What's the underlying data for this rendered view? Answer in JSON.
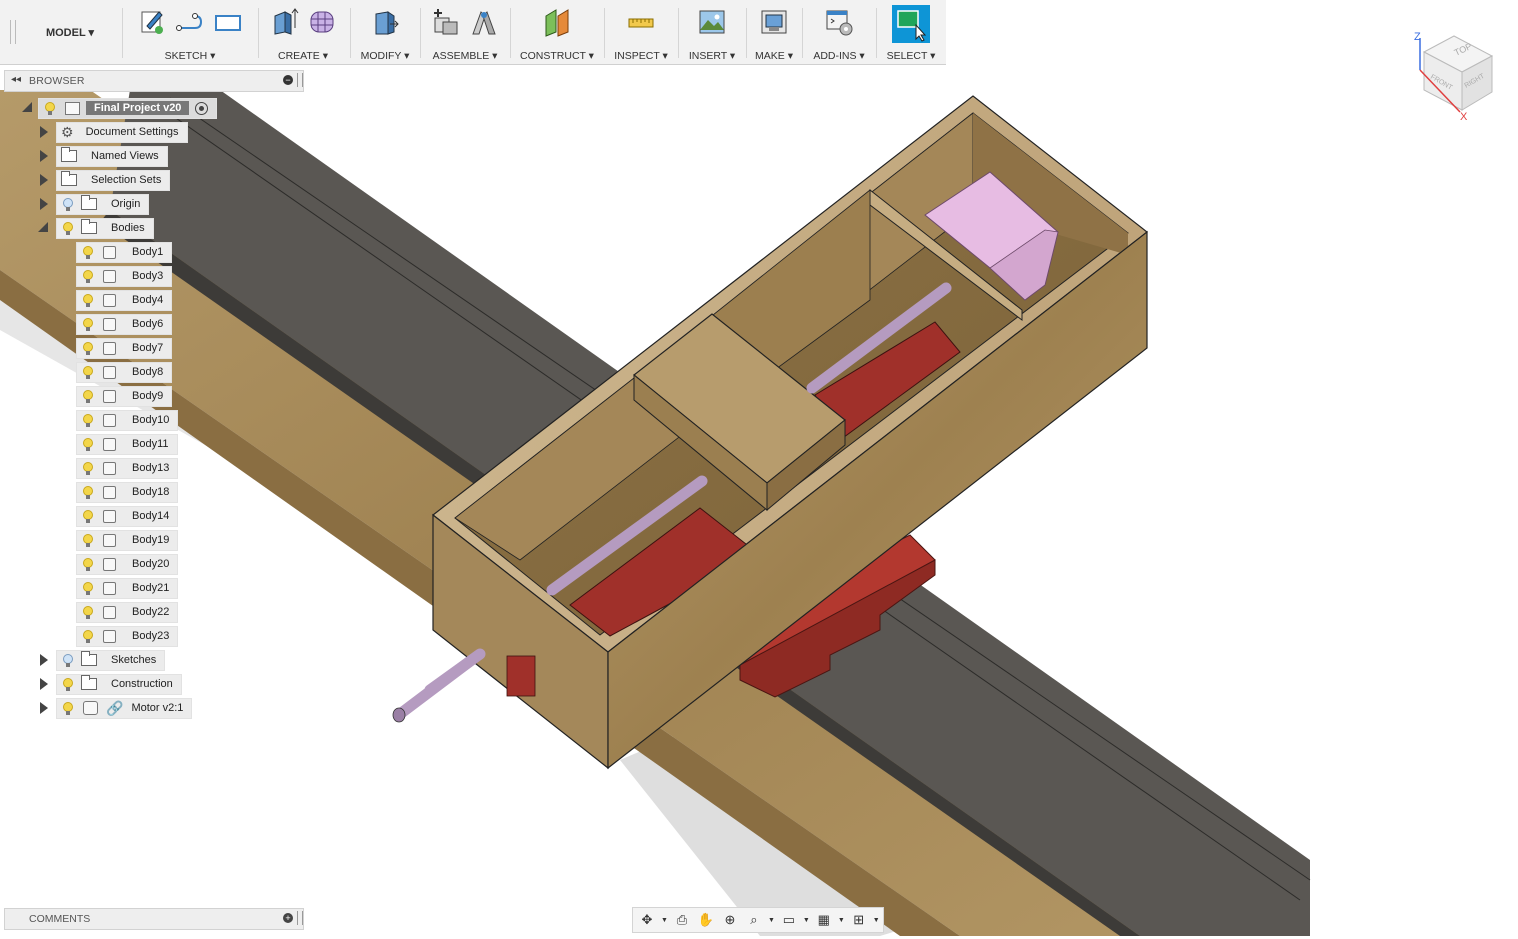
{
  "toolbar": {
    "mode": "MODEL ▾",
    "groups": [
      {
        "label": "SKETCH ▾"
      },
      {
        "label": "CREATE ▾"
      },
      {
        "label": "MODIFY ▾"
      },
      {
        "label": "ASSEMBLE ▾"
      },
      {
        "label": "CONSTRUCT ▾"
      },
      {
        "label": "INSPECT ▾"
      },
      {
        "label": "INSERT ▾"
      },
      {
        "label": "MAKE ▾"
      },
      {
        "label": "ADD-INS ▾"
      },
      {
        "label": "SELECT ▾"
      }
    ]
  },
  "browser": {
    "title": "BROWSER",
    "root": "Final Project v20",
    "top_items": [
      "Document Settings",
      "Named Views",
      "Selection Sets",
      "Origin",
      "Bodies"
    ],
    "bodies": [
      "Body1",
      "Body3",
      "Body4",
      "Body6",
      "Body7",
      "Body8",
      "Body9",
      "Body10",
      "Body11",
      "Body13",
      "Body18",
      "Body14",
      "Body19",
      "Body20",
      "Body21",
      "Body22",
      "Body23"
    ],
    "bottom_items": [
      "Sketches",
      "Construction",
      "Motor v2:1"
    ]
  },
  "comments": {
    "title": "COMMENTS"
  },
  "viewcube": {
    "faces": [
      "TOP",
      "FRONT",
      "RIGHT"
    ],
    "axes": [
      "Z",
      "X"
    ]
  },
  "colors": {
    "accent": "#0e95d6",
    "wood": "#a88d5e",
    "rail": "#5a5753",
    "red": "#a8302a",
    "rod": "#b59bc0",
    "pink": "#e7bce3"
  }
}
